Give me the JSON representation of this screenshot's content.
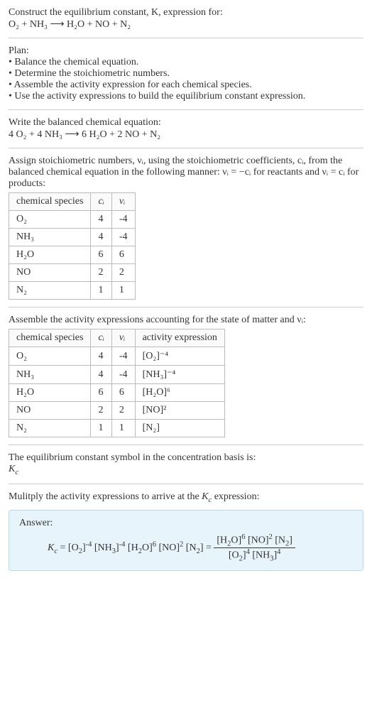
{
  "intro": {
    "line1": "Construct the equilibrium constant, K, expression for:",
    "reaction": "O₂ + NH₃ ⟶ H₂O + NO + N₂"
  },
  "plan": {
    "heading": "Plan:",
    "items": [
      "• Balance the chemical equation.",
      "• Determine the stoichiometric numbers.",
      "• Assemble the activity expression for each chemical species.",
      "• Use the activity expressions to build the equilibrium constant expression."
    ]
  },
  "balanced": {
    "heading": "Write the balanced chemical equation:",
    "equation": "4 O₂ + 4 NH₃ ⟶ 6 H₂O + 2 NO + N₂"
  },
  "assign": {
    "text": "Assign stoichiometric numbers, νᵢ, using the stoichiometric coefficients, cᵢ, from the balanced chemical equation in the following manner: νᵢ = −cᵢ for reactants and νᵢ = cᵢ for products:",
    "headers": [
      "chemical species",
      "cᵢ",
      "νᵢ"
    ],
    "rows": [
      {
        "species": "O₂",
        "c": "4",
        "v": "-4"
      },
      {
        "species": "NH₃",
        "c": "4",
        "v": "-4"
      },
      {
        "species": "H₂O",
        "c": "6",
        "v": "6"
      },
      {
        "species": "NO",
        "c": "2",
        "v": "2"
      },
      {
        "species": "N₂",
        "c": "1",
        "v": "1"
      }
    ]
  },
  "assemble": {
    "text": "Assemble the activity expressions accounting for the state of matter and νᵢ:",
    "headers": [
      "chemical species",
      "cᵢ",
      "νᵢ",
      "activity expression"
    ],
    "rows": [
      {
        "species": "O₂",
        "c": "4",
        "v": "-4",
        "act": "[O₂]⁻⁴"
      },
      {
        "species": "NH₃",
        "c": "4",
        "v": "-4",
        "act": "[NH₃]⁻⁴"
      },
      {
        "species": "H₂O",
        "c": "6",
        "v": "6",
        "act": "[H₂O]⁶"
      },
      {
        "species": "NO",
        "c": "2",
        "v": "2",
        "act": "[NO]²"
      },
      {
        "species": "N₂",
        "c": "1",
        "v": "1",
        "act": "[N₂]"
      }
    ]
  },
  "symbol": {
    "text": "The equilibrium constant symbol in the concentration basis is:",
    "value": "K_c"
  },
  "multiply": {
    "text": "Mulitply the activity expressions to arrive at the K_c expression:"
  },
  "answer": {
    "label": "Answer:",
    "lhs": "K_c = [O₂]⁻⁴ [NH₃]⁻⁴ [H₂O]⁶ [NO]² [N₂] =",
    "num": "[H₂O]⁶ [NO]² [N₂]",
    "den": "[O₂]⁴ [NH₃]⁴"
  },
  "chart_data": {
    "type": "table",
    "tables": [
      {
        "title": "Stoichiometric numbers",
        "columns": [
          "chemical species",
          "c_i",
          "ν_i"
        ],
        "rows": [
          [
            "O2",
            4,
            -4
          ],
          [
            "NH3",
            4,
            -4
          ],
          [
            "H2O",
            6,
            6
          ],
          [
            "NO",
            2,
            2
          ],
          [
            "N2",
            1,
            1
          ]
        ]
      },
      {
        "title": "Activity expressions",
        "columns": [
          "chemical species",
          "c_i",
          "ν_i",
          "activity expression"
        ],
        "rows": [
          [
            "O2",
            4,
            -4,
            "[O2]^-4"
          ],
          [
            "NH3",
            4,
            -4,
            "[NH3]^-4"
          ],
          [
            "H2O",
            6,
            6,
            "[H2O]^6"
          ],
          [
            "NO",
            2,
            2,
            "[NO]^2"
          ],
          [
            "N2",
            1,
            1,
            "[N2]"
          ]
        ]
      }
    ],
    "balanced_equation": "4 O2 + 4 NH3 -> 6 H2O + 2 NO + N2",
    "equilibrium_expression": "K_c = [H2O]^6 [NO]^2 [N2] / ([O2]^4 [NH3]^4)"
  }
}
